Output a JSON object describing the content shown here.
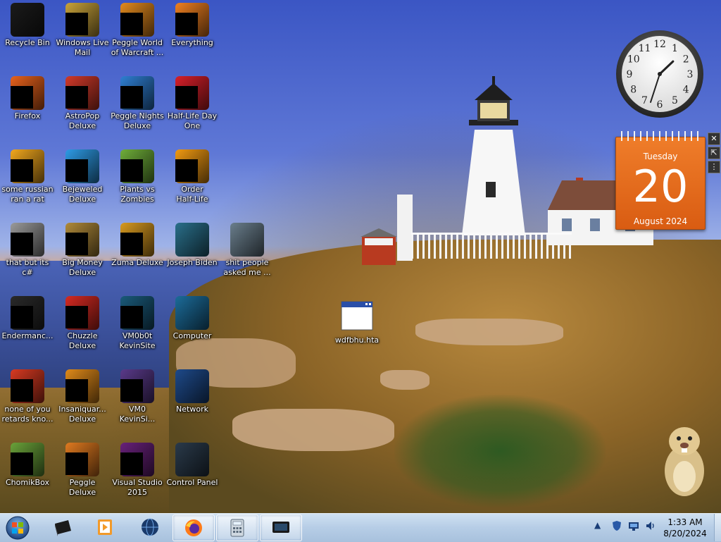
{
  "desktop": {
    "icons": [
      {
        "id": "recycle-bin",
        "label": "Recycle Bin",
        "col": 0,
        "row": 0,
        "color": "#1b1b1b",
        "censored": false
      },
      {
        "id": "windows-live-mail",
        "label": "Windows Live\nMail",
        "col": 1,
        "row": 0,
        "color": "#c9a33a",
        "censored": true
      },
      {
        "id": "peggle-world-of-warcraft",
        "label": "Peggle World\nof Warcraft ...",
        "col": 2,
        "row": 0,
        "color": "#e38a1e",
        "censored": true
      },
      {
        "id": "everything",
        "label": "Everything",
        "col": 3,
        "row": 0,
        "color": "#f08020",
        "censored": true
      },
      {
        "id": "firefox",
        "label": "Firefox",
        "col": 0,
        "row": 1,
        "color": "#e8621c",
        "censored": true
      },
      {
        "id": "astropop-deluxe",
        "label": "AstroPop\nDeluxe",
        "col": 1,
        "row": 1,
        "color": "#d23a2a",
        "censored": true
      },
      {
        "id": "peggle-nights-deluxe",
        "label": "Peggle Nights\nDeluxe",
        "col": 2,
        "row": 1,
        "color": "#2f7fd3",
        "censored": true
      },
      {
        "id": "half-life-day-one",
        "label": "Half-Life Day\nOne",
        "col": 3,
        "row": 1,
        "color": "#d8202a",
        "censored": true
      },
      {
        "id": "some-russian-ran-a-rat",
        "label": "some russian\nran a rat",
        "col": 0,
        "row": 2,
        "color": "#f2a81e",
        "censored": true
      },
      {
        "id": "bejeweled-deluxe",
        "label": "Bejeweled\nDeluxe",
        "col": 1,
        "row": 2,
        "color": "#2e9be6",
        "censored": true
      },
      {
        "id": "plants-vs-zombies",
        "label": "Plants vs\nZombies",
        "col": 2,
        "row": 2,
        "color": "#6fae3a",
        "censored": true
      },
      {
        "id": "order-half-life",
        "label": "Order\nHalf-Life",
        "col": 3,
        "row": 2,
        "color": "#f29a12",
        "censored": true
      },
      {
        "id": "that-but-its-csharp",
        "label": "that but its c#",
        "col": 0,
        "row": 3,
        "color": "#9a9a9a",
        "censored": true
      },
      {
        "id": "big-money-deluxe",
        "label": "Big Money\nDeluxe",
        "col": 1,
        "row": 3,
        "color": "#b08a3a",
        "censored": true
      },
      {
        "id": "zuma-deluxe",
        "label": "Zuma Deluxe",
        "col": 2,
        "row": 3,
        "color": "#d89a20",
        "censored": true
      },
      {
        "id": "joseph-biden",
        "label": "Joseph Biden",
        "col": 3,
        "row": 3,
        "color": "#2a6f8a",
        "censored": false
      },
      {
        "id": "shit-people-asked-me",
        "label": "shit people\nasked me ...",
        "col": 4,
        "row": 3,
        "color": "#6a7e8c",
        "censored": false
      },
      {
        "id": "endermanch",
        "label": "Endermanc...",
        "col": 0,
        "row": 4,
        "color": "#2a2a2a",
        "censored": true
      },
      {
        "id": "chuzzle-deluxe",
        "label": "Chuzzle\nDeluxe",
        "col": 1,
        "row": 4,
        "color": "#d62a22",
        "censored": true
      },
      {
        "id": "vm0b0t-kevinsite",
        "label": "VM0b0t\nKevinSite",
        "col": 2,
        "row": 4,
        "color": "#1a5a7a",
        "censored": true
      },
      {
        "id": "computer",
        "label": "Computer",
        "col": 3,
        "row": 4,
        "color": "#1c6c9a",
        "censored": false
      },
      {
        "id": "none-of-you-retards",
        "label": "none of you\nretards kno...",
        "col": 0,
        "row": 5,
        "color": "#d83a22",
        "censored": true
      },
      {
        "id": "insaniquarium-deluxe",
        "label": "Insaniquar...\nDeluxe",
        "col": 1,
        "row": 5,
        "color": "#e08a1a",
        "censored": true
      },
      {
        "id": "vm0-kevinsi",
        "label": "VM0\nKevinSi...",
        "col": 2,
        "row": 5,
        "color": "#5a3a8a",
        "censored": true
      },
      {
        "id": "network",
        "label": "Network",
        "col": 3,
        "row": 5,
        "color": "#1e4a8a",
        "censored": false
      },
      {
        "id": "chomikbox",
        "label": "ChomikBox",
        "col": 0,
        "row": 6,
        "color": "#6aa23a",
        "censored": true
      },
      {
        "id": "peggle-deluxe",
        "label": "Peggle Deluxe",
        "col": 1,
        "row": 6,
        "color": "#e07a20",
        "censored": true
      },
      {
        "id": "visual-studio-2015",
        "label": "Visual Studio\n2015",
        "col": 2,
        "row": 6,
        "color": "#68217a",
        "censored": true
      },
      {
        "id": "control-panel",
        "label": "Control Panel",
        "col": 3,
        "row": 6,
        "color": "#2a3a4a",
        "censored": false
      }
    ],
    "file_icon": {
      "label": "wdfbhu.hta"
    }
  },
  "clock_gadget": {
    "hour": 1,
    "minute": 33
  },
  "calendar_gadget": {
    "weekday": "Tuesday",
    "day": "20",
    "month_year": "August 2024"
  },
  "gadget_controls": {
    "close": "✕",
    "size": "⇱",
    "drag": "⋮"
  },
  "taskbar": {
    "items": [
      {
        "id": "start",
        "name": "windows-start-orb"
      },
      {
        "id": "task-1",
        "name": "media-center-icon",
        "active": false
      },
      {
        "id": "task-2",
        "name": "media-player-icon",
        "active": false
      },
      {
        "id": "task-3",
        "name": "globe-icon",
        "active": false
      },
      {
        "id": "task-4",
        "name": "firefox-icon",
        "active": true
      },
      {
        "id": "task-5",
        "name": "calculator-icon",
        "active": true
      },
      {
        "id": "task-6",
        "name": "monitor-icon",
        "active": true
      }
    ],
    "tray": {
      "overflow": "▲",
      "icons": [
        "defender-icon",
        "network-monitor-icon",
        "volume-icon"
      ]
    },
    "time": "1:33 AM",
    "date": "8/20/2024"
  }
}
